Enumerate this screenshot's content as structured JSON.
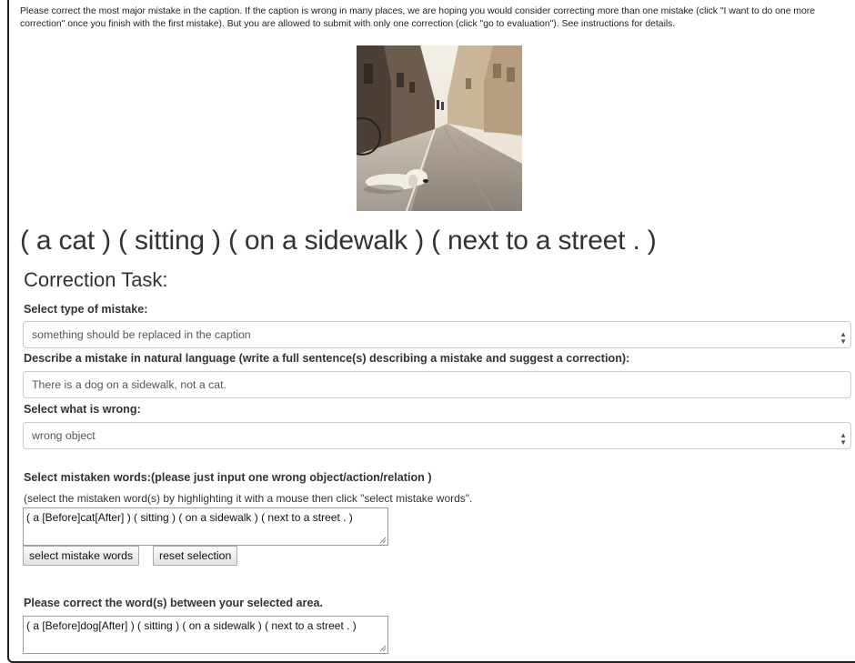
{
  "instructions": "Please correct the most major mistake in the caption. If the caption is wrong in many places, we are hoping you would consider correcting more than one mistake (click \"I want to do one more correction\" once you finish with the first mistake). But you are allowed to submit with only one correction (click \"go to evaluation\"). See instructions for details.",
  "photo": {
    "icon": "street-dog-photo"
  },
  "caption": "( a cat ) ( sitting ) ( on a sidewalk ) ( next to a street . )",
  "task_title": "Correction Task:",
  "mistake_type": {
    "label": "Select type of mistake:",
    "selected": "something should be replaced in the caption"
  },
  "describe": {
    "label": "Describe a mistake in natural language (write a full sentence(s) describing a mistake and suggest a correction):",
    "value": "There is a dog on a sidewalk, not a cat."
  },
  "what_wrong": {
    "label": "Select what is wrong:",
    "selected": "wrong object"
  },
  "mistaken_words": {
    "label": "Select mistaken words:(please just input one wrong object/action/relation )",
    "hint": "(select the mistaken word(s) by highlighting it with a mouse then click \"select mistake words\".",
    "value": "( a [Before]cat[After] ) ( sitting ) ( on a sidewalk ) ( next to a street . )",
    "select_button": "select mistake words",
    "reset_button": "reset selection"
  },
  "correction": {
    "label": "Please correct the word(s) between your selected area.",
    "value": "( a [Before]dog[After] ) ( sitting ) ( on a sidewalk ) ( next to a street . )"
  }
}
